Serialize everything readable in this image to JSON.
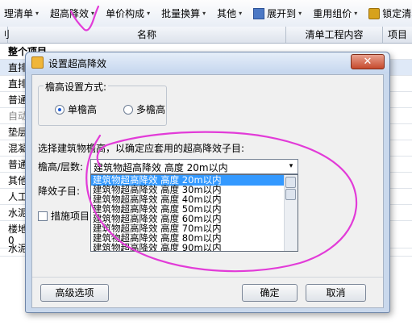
{
  "toolbar": {
    "items": [
      {
        "label": "理清单",
        "caret": "▾"
      },
      {
        "label": "超高降效",
        "caret": "▾"
      },
      {
        "label": "单价构成",
        "caret": "▾"
      },
      {
        "label": "批量换算",
        "caret": "▾"
      },
      {
        "label": "其他",
        "caret": "▾"
      },
      {
        "label": "展开到",
        "caret": "▾"
      },
      {
        "label": "重用组价",
        "caret": "▾"
      },
      {
        "label": "锁定清单"
      }
    ]
  },
  "grid": {
    "headers": [
      "刂",
      "名称",
      "清单工程内容",
      "项目"
    ],
    "rows": [
      {
        "text": "整个项目",
        "style": "bold"
      },
      {
        "text": "直排",
        "style": "sel"
      },
      {
        "text": "直排",
        "style": ""
      },
      {
        "text": "普通",
        "style": ""
      },
      {
        "text": "自动",
        "style": "gray"
      },
      {
        "text": "垫层",
        "style": ""
      },
      {
        "text": "混凝",
        "style": ""
      },
      {
        "text": "普通",
        "style": ""
      },
      {
        "text": "其他",
        "style": ""
      },
      {
        "text": "人工",
        "style": ""
      },
      {
        "text": "水泥",
        "style": ""
      },
      {
        "text": "楼地",
        "style": ""
      },
      {
        "text": "0",
        "style": ""
      },
      {
        "text": "水泥",
        "style": ""
      }
    ]
  },
  "dialog": {
    "title": "设置超高降效",
    "close_glyph": "✕",
    "group_legend": "檐高设置方式:",
    "radio_single": "单檐高",
    "radio_multi": "多檐高",
    "instruction": "选择建筑物檐高，以确定应套用的超高降效子目:",
    "label_height": "檐高/层数:",
    "label_sub": "降效子目:",
    "checkbox_label": "措施项目",
    "combo_value": "建筑物超高降效 高度 20m以内",
    "combo_caret": "▾",
    "options": [
      "建筑物超高降效 高度 20m以内",
      "建筑物超高降效 高度 30m以内",
      "建筑物超高降效 高度 40m以内",
      "建筑物超高降效 高度 50m以内",
      "建筑物超高降效 高度 60m以内",
      "建筑物超高降效 高度 70m以内",
      "建筑物超高降效 高度 80m以内",
      "建筑物超高降效 高度 90m以内"
    ],
    "btn_advanced": "高级选项",
    "btn_ok": "确定",
    "btn_cancel": "取消"
  },
  "colors": {
    "highlight": "#3399ff",
    "annotation": "#e23bd8",
    "dialog_frame": "#c9d8ec"
  }
}
